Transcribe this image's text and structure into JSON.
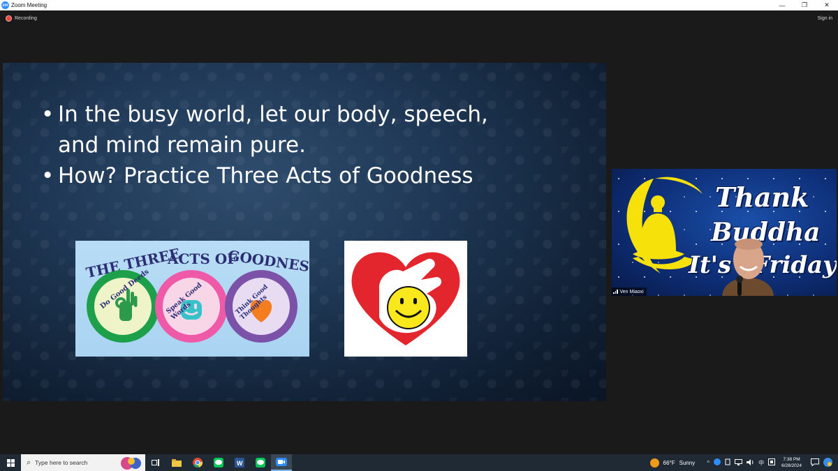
{
  "window": {
    "title": "Zoom Meeting",
    "app_icon_text": "zm",
    "controls": {
      "minimize": "—",
      "restore": "❐",
      "close": "✕"
    }
  },
  "meeting_bar": {
    "recording_label": "Recording",
    "sign_in_label": "Sign in"
  },
  "slide": {
    "bullets": [
      "In the busy world, let our body, speech, and mind remain pure.",
      "How?  Practice Three Acts of Goodness"
    ],
    "picture1": {
      "heading_words": [
        "THE THREE",
        "ACTS OF",
        "GOODNESS"
      ],
      "circles": [
        {
          "label": "Do Good Deeds",
          "outer": "#1ea04a",
          "inner": "#eef3c8"
        },
        {
          "label": "Speak Good Words",
          "outer": "#ee5aa8",
          "inner": "#f8d6e8"
        },
        {
          "label": "Think Good Thoughts",
          "outer": "#7b52a8",
          "inner": "#e7dcf2"
        }
      ]
    }
  },
  "participant": {
    "name": "Ven Miaoxi",
    "banner_words": [
      "Thank",
      "Buddha",
      "It's",
      "Friday"
    ]
  },
  "taskbar": {
    "search_placeholder": "Type here to search",
    "weather": {
      "temp": "66°F",
      "condition": "Sunny"
    },
    "tray_glyphs": [
      "^",
      "中"
    ],
    "clock": {
      "time": "7:38 PM",
      "date": "6/28/2024"
    }
  },
  "colors": {
    "zoom_blue": "#2d8cff",
    "recording_red": "#e8483f",
    "heart_red": "#e3262d",
    "smiley_yellow": "#f9e81c"
  }
}
